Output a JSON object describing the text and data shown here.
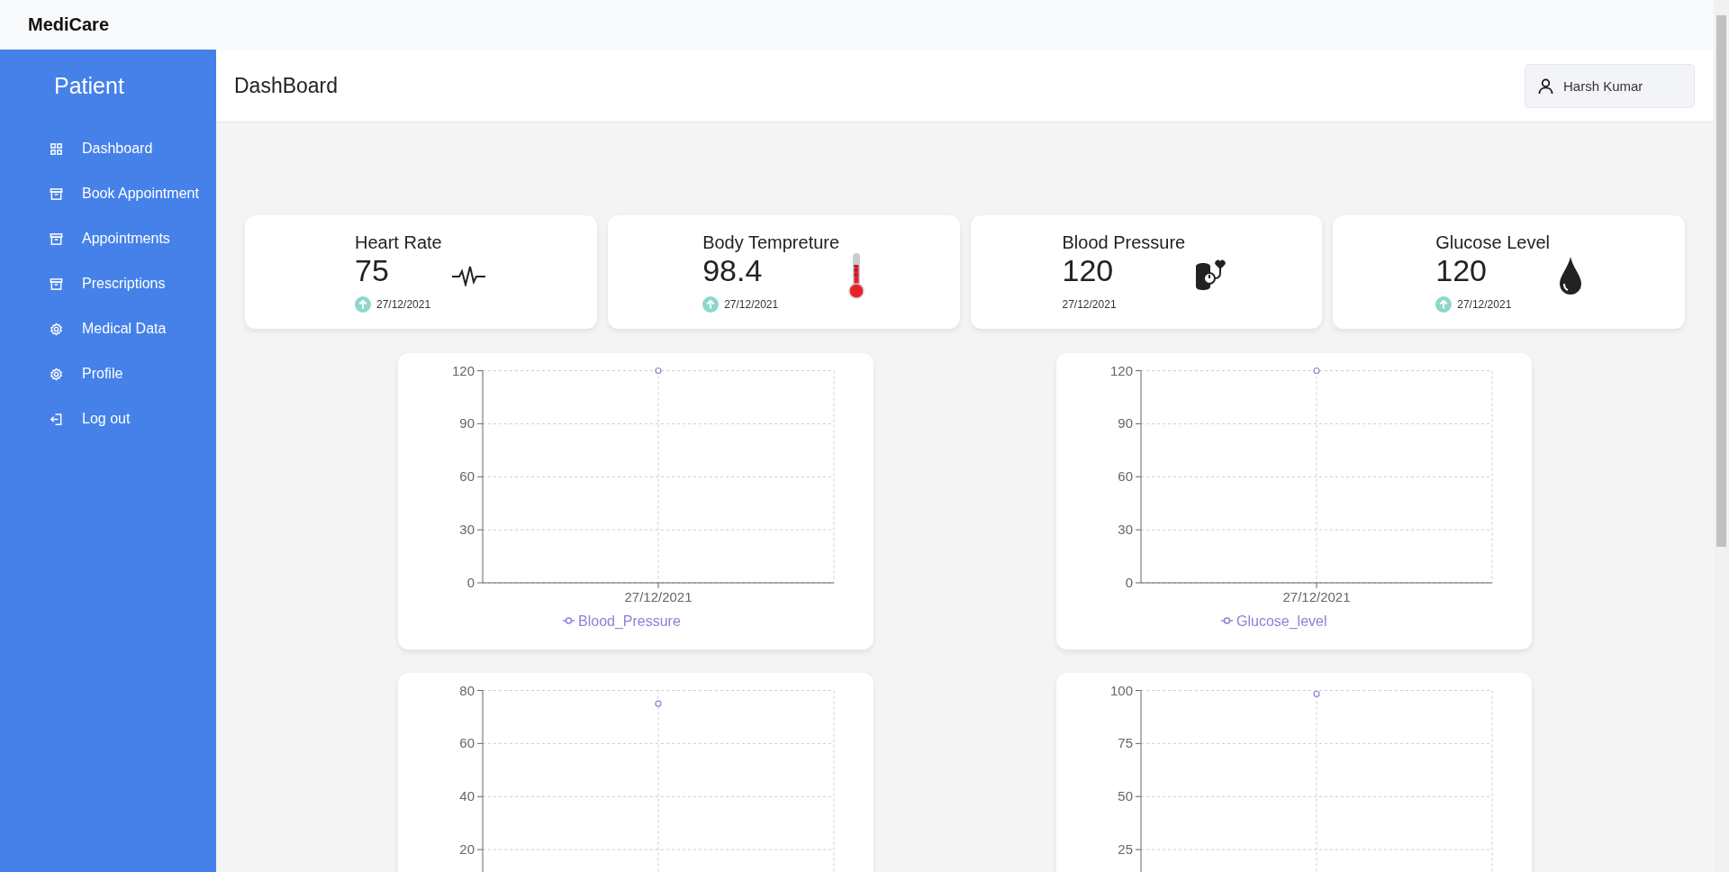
{
  "brand": "MediCare",
  "sidebar": {
    "title": "Patient",
    "items": [
      {
        "label": "Dashboard",
        "kind": "grid"
      },
      {
        "label": "Book Appointment",
        "kind": "archive"
      },
      {
        "label": "Appointments",
        "kind": "archive"
      },
      {
        "label": "Prescriptions",
        "kind": "archive"
      },
      {
        "label": "Medical Data",
        "kind": "gear"
      },
      {
        "label": "Profile",
        "kind": "gear"
      },
      {
        "label": "Log out",
        "kind": "logout"
      }
    ]
  },
  "header": {
    "title": "DashBoard",
    "user": "Harsh Kumar"
  },
  "metrics": [
    {
      "title": "Heart Rate",
      "value": "75",
      "date": "27/12/2021",
      "trend_up": true,
      "kind": "pulse"
    },
    {
      "title": "Body Tempreture",
      "value": "98.4",
      "date": "27/12/2021",
      "trend_up": true,
      "kind": "thermometer"
    },
    {
      "title": "Blood Pressure",
      "value": "120",
      "date": "27/12/2021",
      "trend_up": false,
      "kind": "cuff"
    },
    {
      "title": "Glucose Level",
      "value": "120",
      "date": "27/12/2021",
      "trend_up": true,
      "kind": "drop"
    }
  ],
  "charts": [
    {
      "chart_data": {
        "type": "line",
        "grid": true,
        "categories": [
          "27/12/2021"
        ],
        "series": [
          {
            "name": "Blood_Pressure",
            "color": "#8884d8",
            "marker": "circle",
            "values": [
              120
            ]
          }
        ],
        "ylim": [
          0,
          120
        ],
        "yticks": [
          0,
          30,
          60,
          90,
          120
        ]
      }
    },
    {
      "chart_data": {
        "type": "line",
        "grid": true,
        "categories": [
          "27/12/2021"
        ],
        "series": [
          {
            "name": "Glucose_level",
            "color": "#8884d8",
            "marker": "circle",
            "values": [
              120
            ]
          }
        ],
        "ylim": [
          0,
          120
        ],
        "yticks": [
          0,
          30,
          60,
          90,
          120
        ]
      }
    },
    {
      "chart_data": {
        "type": "line",
        "grid": true,
        "series": [
          {
            "color": "#8884d8",
            "marker": "circle",
            "values": [
              75
            ]
          }
        ],
        "ylim": [
          0,
          80
        ],
        "yticks": [
          20,
          40,
          60,
          80
        ]
      }
    },
    {
      "chart_data": {
        "type": "line",
        "grid": true,
        "series": [
          {
            "color": "#8884d8",
            "marker": "circle",
            "values": [
              98.4
            ]
          }
        ],
        "ylim": [
          0,
          100
        ],
        "yticks": [
          25,
          50,
          75,
          100
        ]
      }
    }
  ]
}
